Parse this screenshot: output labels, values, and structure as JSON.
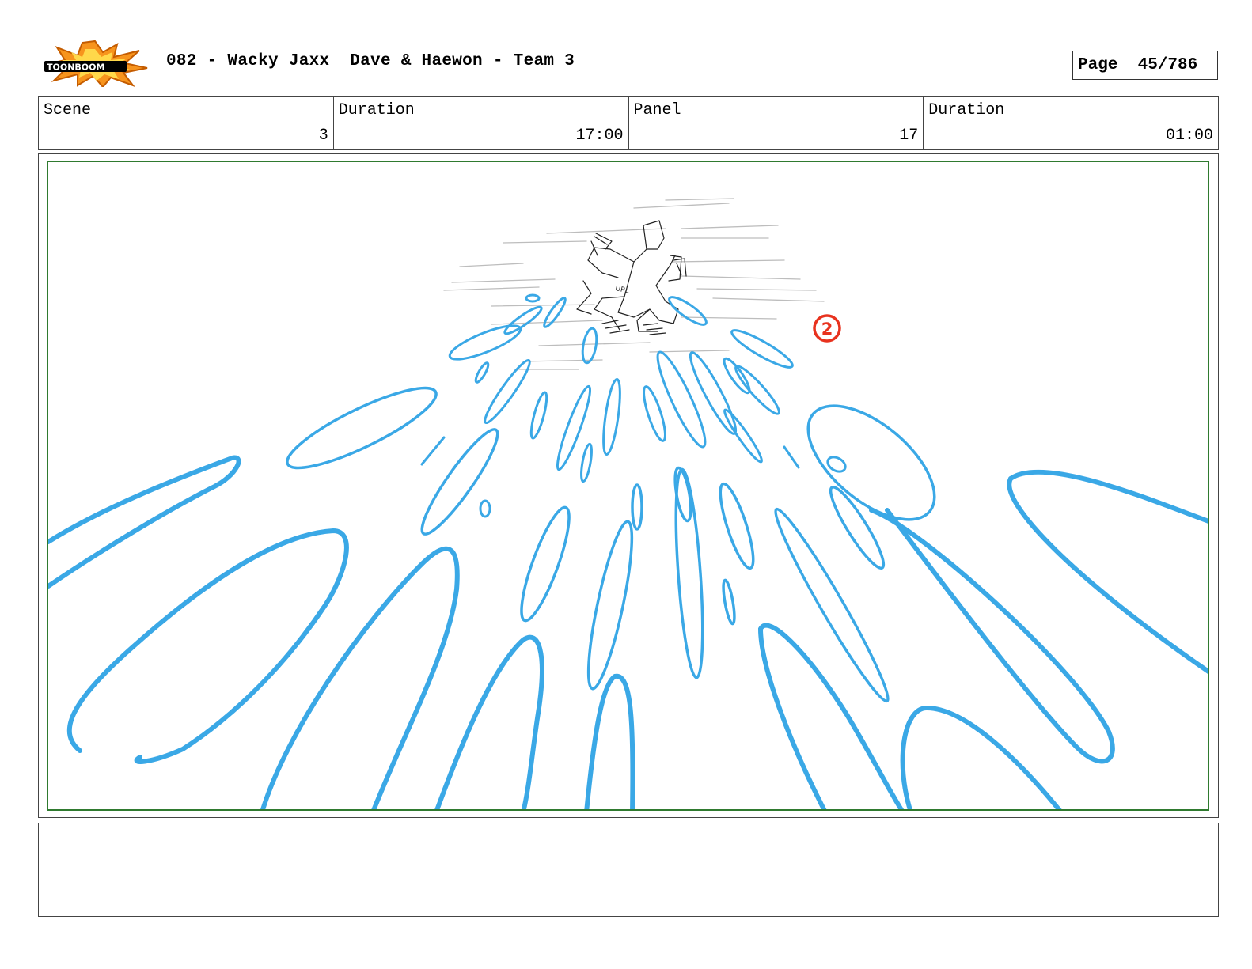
{
  "header": {
    "logo_text": "TOONBOOM",
    "title": "082 - Wacky Jaxx  Dave & Haewon - Team 3",
    "page": "Page  45/786"
  },
  "info": {
    "scene_label": "Scene",
    "scene_value": "3",
    "scene_duration_label": "Duration",
    "scene_duration_value": "17:00",
    "panel_label": "Panel",
    "panel_value": "17",
    "panel_duration_label": "Duration",
    "panel_duration_value": "01:00"
  },
  "panel": {
    "marker_number": "2",
    "sketch_label": "URL",
    "colors": {
      "splash": "#3aa8e6",
      "marker": "#e8321e",
      "frame": "#2f7a2f",
      "pencil": "#222222"
    }
  },
  "notes": {
    "text": ""
  }
}
